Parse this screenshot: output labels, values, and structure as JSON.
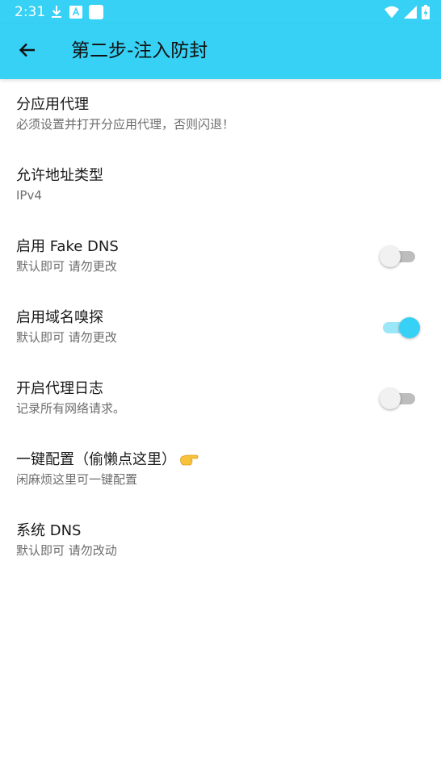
{
  "colors": {
    "accent": "#36d1f5",
    "switch_track_on": "#9be6f7",
    "switch_track_off": "#bdbdbd",
    "switch_knob_off": "#f1f1f1"
  },
  "status_bar": {
    "time": "2:31",
    "left_icons": [
      "download-icon",
      "text-app-icon",
      "app-square-icon"
    ],
    "right_icons": [
      "wifi-icon",
      "signal-icon",
      "battery-charging-icon"
    ]
  },
  "app_bar": {
    "back_icon": "arrow-back-icon",
    "title": "第二步-注入防封"
  },
  "settings": [
    {
      "title": "分应用代理",
      "subtitle": "必须设置并打开分应用代理，否则闪退！"
    },
    {
      "title": "允许地址类型",
      "subtitle": "IPv4"
    },
    {
      "title": "启用 Fake DNS",
      "subtitle": "默认即可 请勿更改",
      "toggle": false
    },
    {
      "title": "启用域名嗅探",
      "subtitle": "默认即可 请勿更改",
      "toggle": true
    },
    {
      "title": "开启代理日志",
      "subtitle": "记录所有网络请求。",
      "toggle": false
    },
    {
      "title": "一键配置（偷懒点这里）",
      "subtitle": "闲麻烦这里可一键配置",
      "icon": "pointing-hand-icon"
    },
    {
      "title": "系统 DNS",
      "subtitle": "默认即可 请勿改动"
    }
  ]
}
